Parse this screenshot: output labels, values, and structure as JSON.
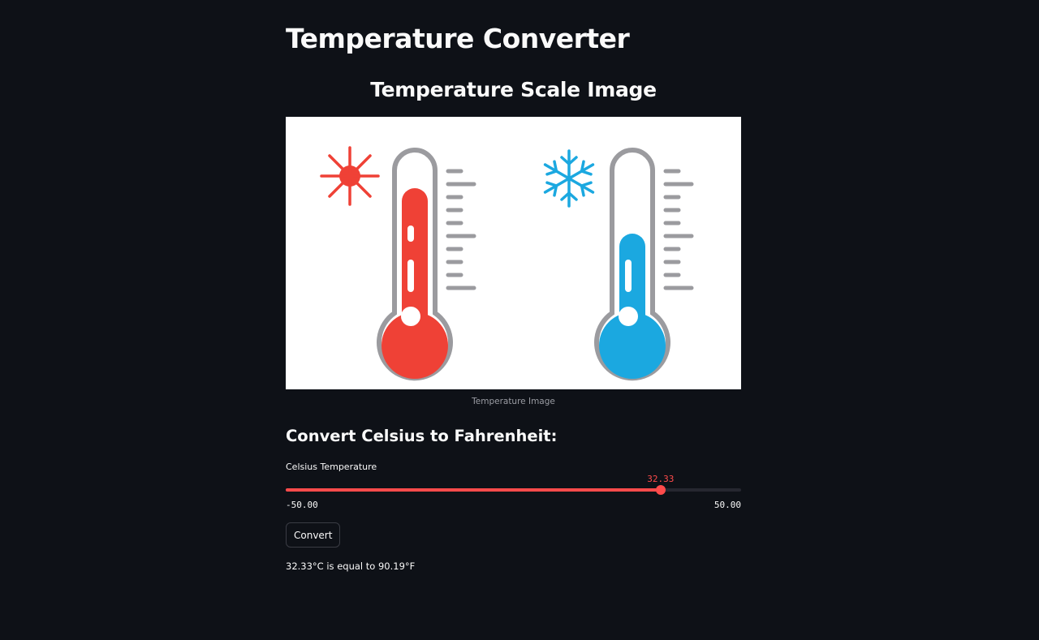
{
  "page": {
    "title": "Temperature Converter"
  },
  "image_section": {
    "heading": "Temperature Scale Image",
    "caption": "Temperature Image",
    "icons": [
      "sun-icon",
      "hot-thermometer-icon",
      "snowflake-icon",
      "cold-thermometer-icon"
    ],
    "colors": {
      "hot": "#ef4136",
      "cold": "#1ba8e0",
      "outline": "#9b9b9f"
    }
  },
  "converter": {
    "heading": "Convert Celsius to Fahrenheit:",
    "slider": {
      "label": "Celsius Temperature",
      "value": 32.33,
      "value_text": "32.33",
      "min": -50,
      "max": 50,
      "min_text": "-50.00",
      "max_text": "50.00"
    },
    "button_label": "Convert",
    "result": "32.33°C is equal to 90.19°F"
  },
  "theme": {
    "background": "#0e1117",
    "text": "#fafafa",
    "accent": "#ff4b4b"
  }
}
